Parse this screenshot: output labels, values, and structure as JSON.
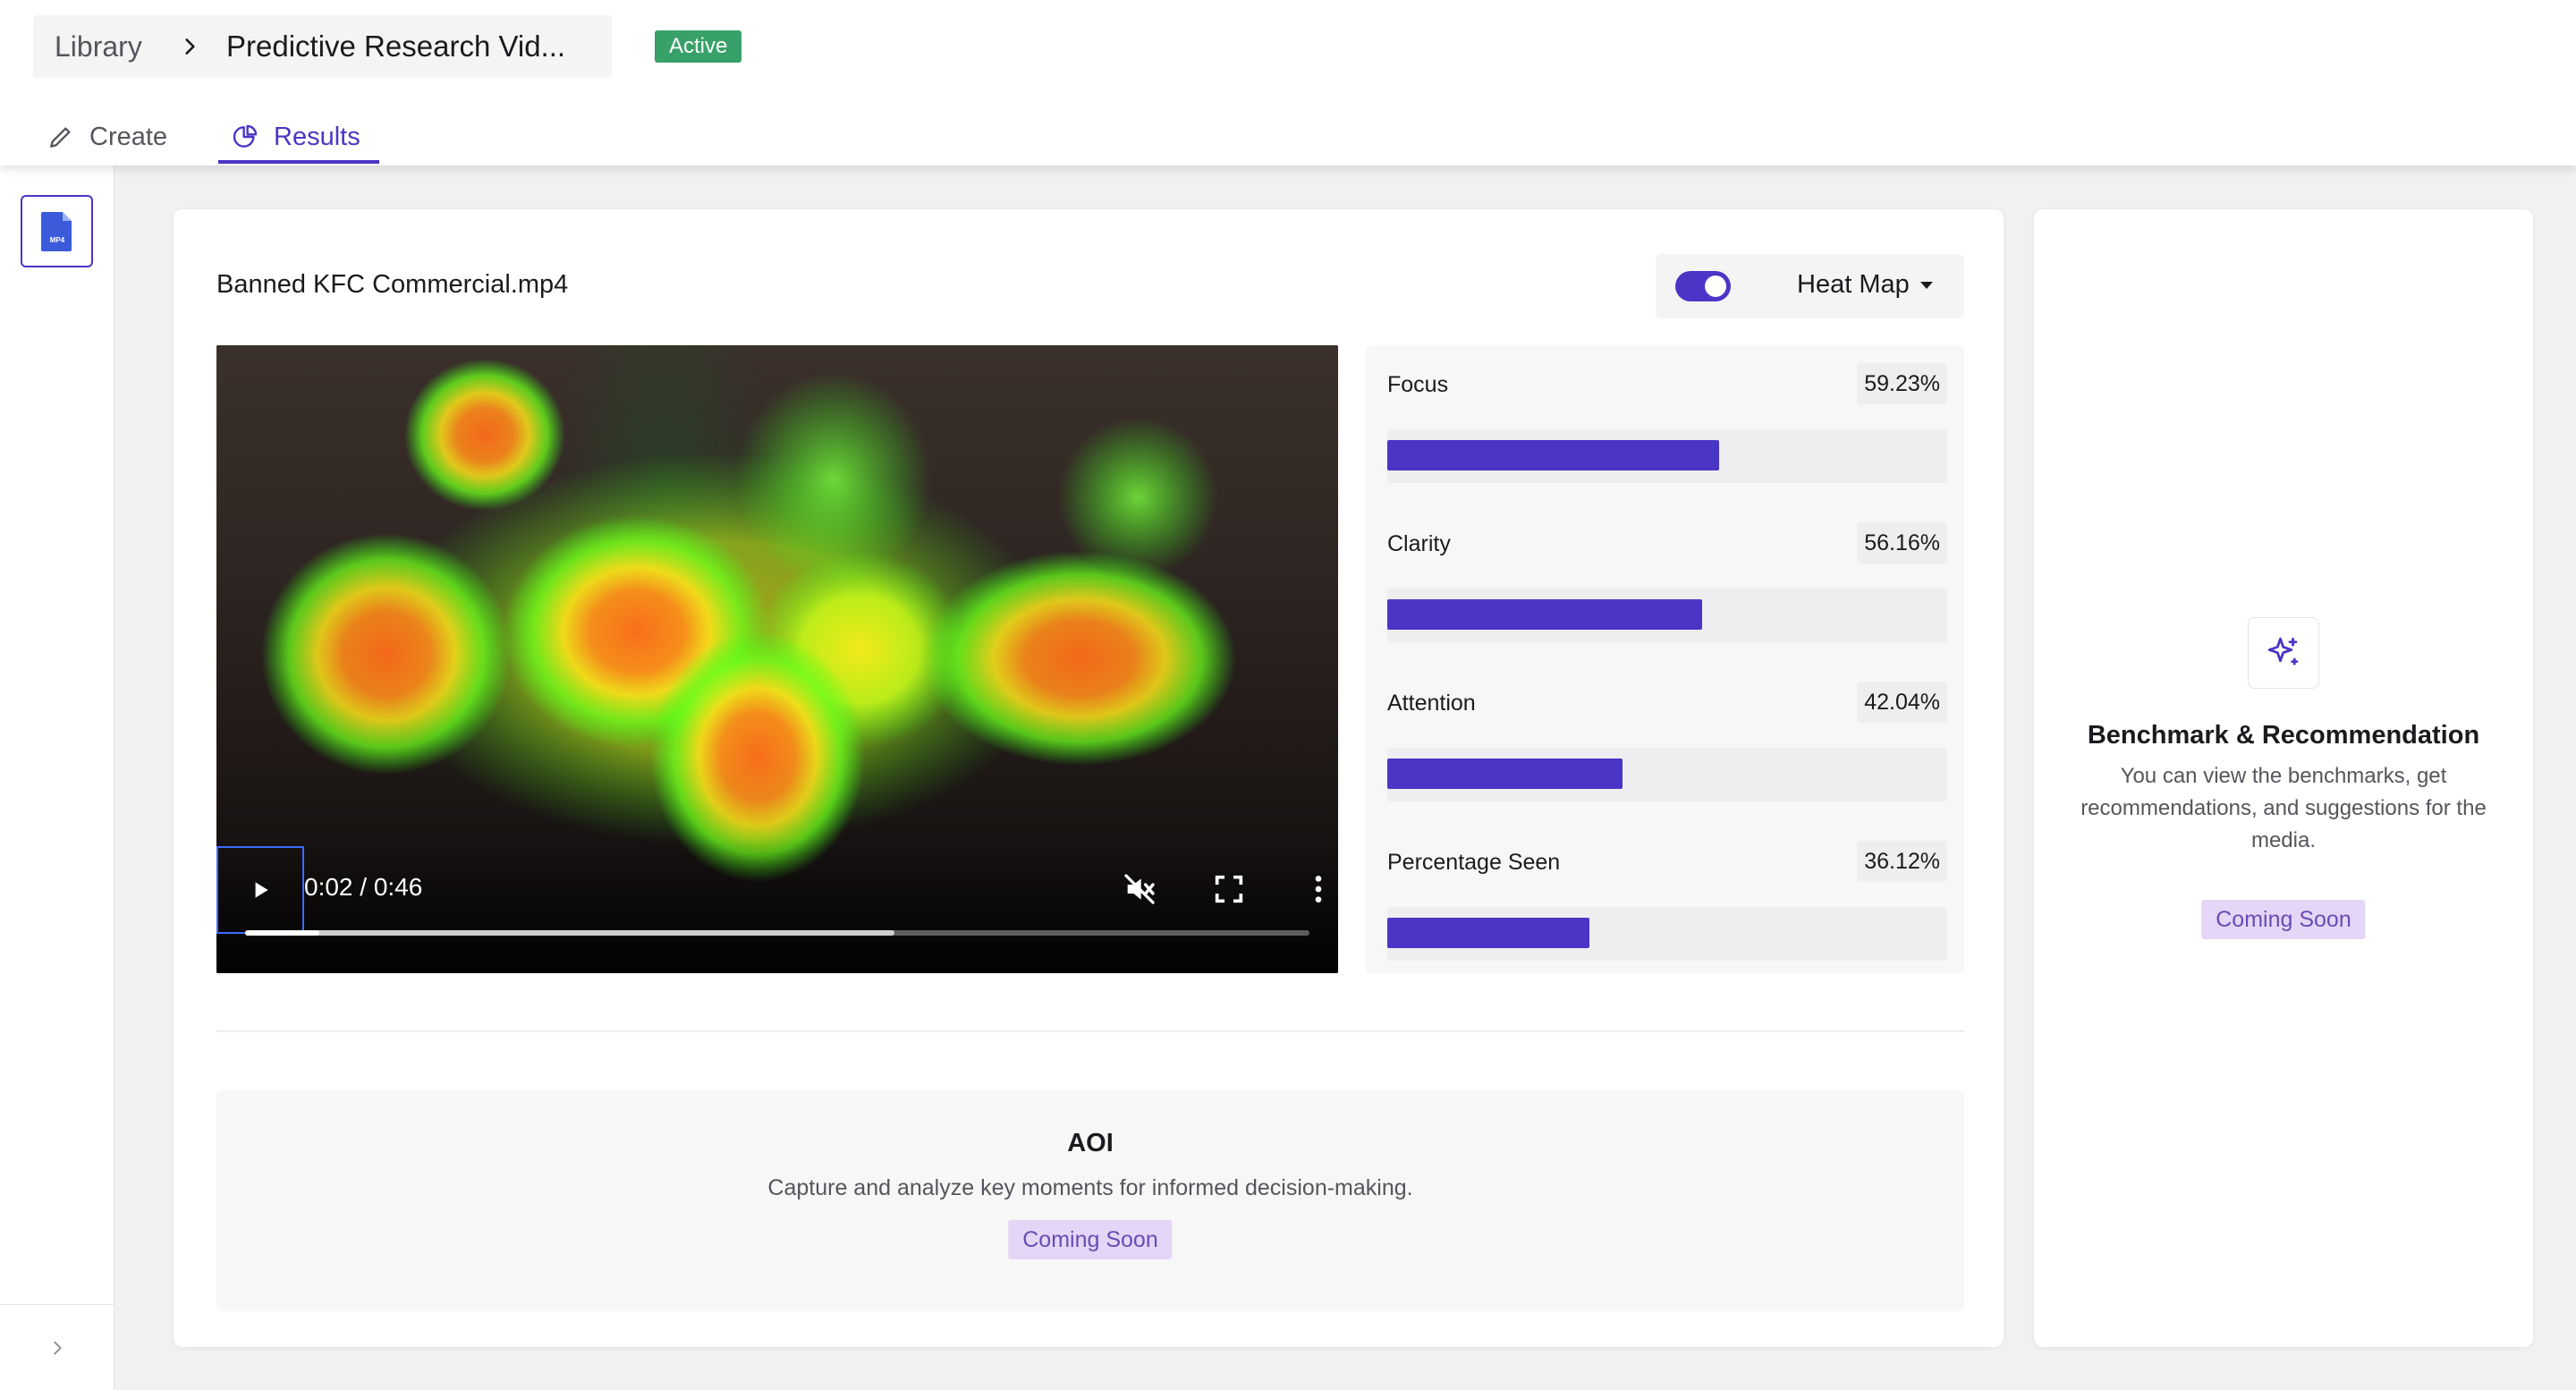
{
  "header": {
    "breadcrumb": {
      "library": "Library",
      "title": "Predictive Research Vid..."
    },
    "status": "Active",
    "tabs": [
      {
        "label": "Create",
        "icon": "pencil-icon"
      },
      {
        "label": "Results",
        "icon": "pie-chart-icon",
        "active": true
      }
    ]
  },
  "sidebar": {
    "file_icon": "mp4-file-icon",
    "file_icon_label": "MP4"
  },
  "main": {
    "file_name": "Banned KFC Commercial.mp4",
    "heatmap_toggle_on": true,
    "view_select": "Heat Map",
    "video": {
      "time": "0:02 / 0:46",
      "played_fraction": 0.07,
      "buffered_fraction": 0.61
    },
    "metrics": [
      {
        "label": "Focus",
        "value": "59.23%",
        "fraction": 0.5923
      },
      {
        "label": "Clarity",
        "value": "56.16%",
        "fraction": 0.5616
      },
      {
        "label": "Attention",
        "value": "42.04%",
        "fraction": 0.4204
      },
      {
        "label": "Percentage Seen",
        "value": "36.12%",
        "fraction": 0.3612
      }
    ],
    "aoi": {
      "title": "AOI",
      "description": "Capture and analyze key moments for informed decision-making.",
      "badge": "Coming Soon"
    }
  },
  "benchmark": {
    "title": "Benchmark & Recommendation",
    "description": "You can view the benchmarks, get recommendations, and suggestions for the media.",
    "badge": "Coming Soon"
  },
  "colors": {
    "accent": "#4b35c6",
    "active_badge": "#38a169",
    "coming_soon_bg": "#e3d6f7",
    "coming_soon_text": "#6b4bb3"
  }
}
